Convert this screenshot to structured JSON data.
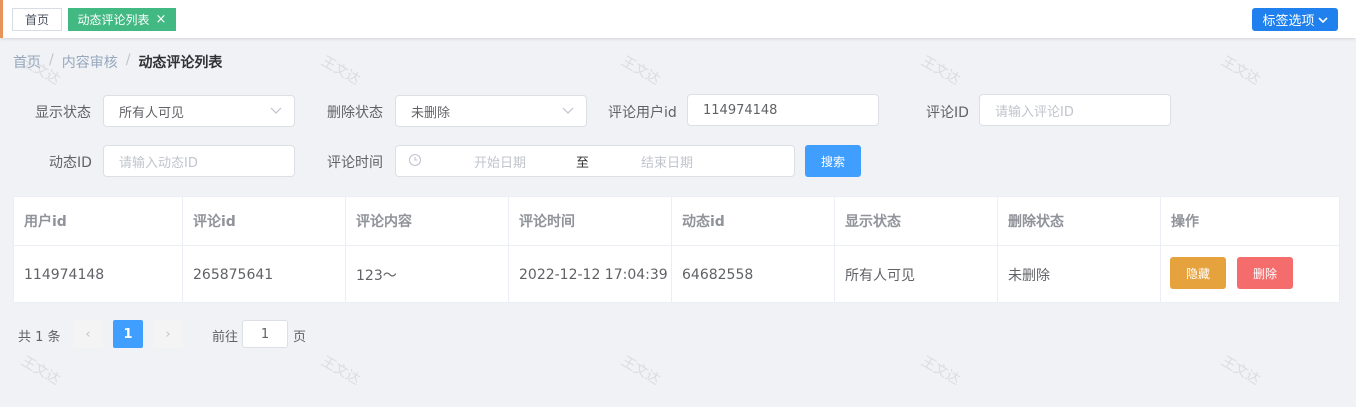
{
  "tags": {
    "home_label": "首页",
    "active_label": "动态评论列表",
    "close_glyph": "×",
    "options_label": "标签选项",
    "options_chevron": "⌄"
  },
  "breadcrumb": {
    "items": [
      "首页",
      "内容审核",
      "动态评论列表"
    ],
    "separator": "/"
  },
  "filters": {
    "display_status": {
      "label": "显示状态",
      "value": "所有人可见"
    },
    "delete_status": {
      "label": "删除状态",
      "value": "未删除"
    },
    "comment_user_id": {
      "label": "评论用户id",
      "value": "114974148"
    },
    "comment_id": {
      "label": "评论ID",
      "placeholder": "请输入评论ID"
    },
    "dynamic_id": {
      "label": "动态ID",
      "placeholder": "请输入动态ID"
    },
    "comment_time": {
      "label": "评论时间",
      "start_placeholder": "开始日期",
      "separator": "至",
      "end_placeholder": "结束日期"
    },
    "search_label": "搜索"
  },
  "table": {
    "headers": [
      "用户id",
      "评论id",
      "评论内容",
      "评论时间",
      "动态id",
      "显示状态",
      "删除状态",
      "操作"
    ],
    "rows": [
      {
        "user_id": "114974148",
        "comment_id": "265875641",
        "content": "123～",
        "time": "2022-12-12 17:04:39",
        "dynamic_id": "64682558",
        "display_status": "所有人可见",
        "delete_status": "未删除",
        "hide_label": "隐藏",
        "delete_label": "删除"
      }
    ]
  },
  "pagination": {
    "total_text": "共 1 条",
    "prev_glyph": "‹",
    "next_glyph": "›",
    "current_page": "1",
    "goto_label": "前往",
    "goto_value": "1",
    "goto_suffix": "页"
  },
  "watermark": "王文达",
  "colors": {
    "tag_active": "#42b983",
    "options_button": "#1f80ee",
    "primary": "#409eff",
    "warning": "#e6a23c",
    "danger": "#f56c6c"
  }
}
